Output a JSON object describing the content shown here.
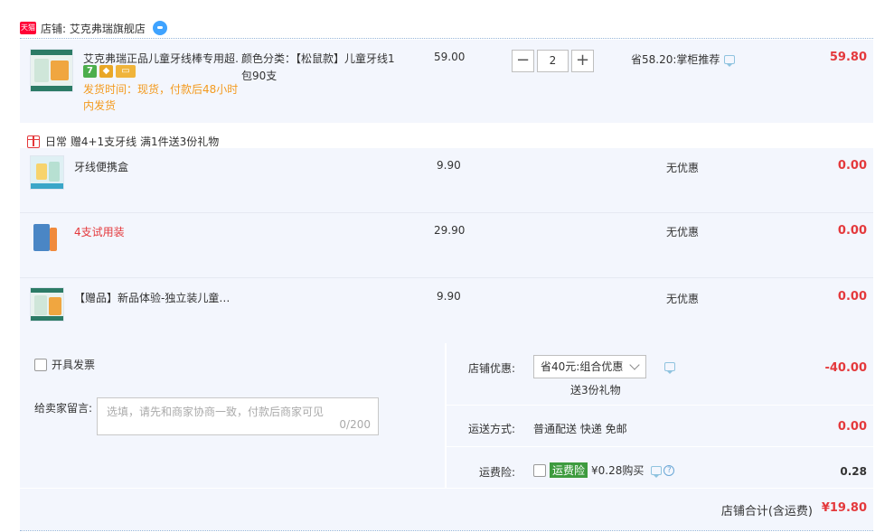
{
  "store": {
    "badge": "天猫",
    "name": "店铺: 艾克弗瑞旗舰店"
  },
  "main_item": {
    "title": "艾克弗瑞正品儿童牙线棒专用超…",
    "ship_time": "发货时间：现货，付款后48小时内发货",
    "sku": "颜色分类：【松鼠款】儿童牙线1包90支",
    "price": "59.00",
    "quantity": "2",
    "minus": "−",
    "plus": "+",
    "savings": "省58.20:掌柜推荐",
    "subtotal": "59.80",
    "mini_icons": [
      "7",
      "◆",
      "▭"
    ]
  },
  "gift": {
    "promo": "日常 赠4+1支牙线   满1件送3份礼物",
    "items": [
      {
        "name": "牙线便携盒",
        "price": "9.90",
        "discount": "无优惠",
        "subtotal": "0.00"
      },
      {
        "name": "4支试用装",
        "price": "29.90",
        "discount": "无优惠",
        "subtotal": "0.00"
      },
      {
        "name": "【赠品】新品体验-独立装儿童…",
        "price": "9.90",
        "discount": "无优惠",
        "subtotal": "0.00"
      }
    ]
  },
  "invoice": {
    "label": "开具发票"
  },
  "message": {
    "label": "给卖家留言:",
    "placeholder": "选填，请先和商家协商一致，付款后商家可见",
    "count": "0/200"
  },
  "discount": {
    "label": "店铺优惠:",
    "selected": "省40元:组合优惠",
    "note": "送3份礼物",
    "value": "-40.00"
  },
  "shipping": {
    "label": "运送方式:",
    "value_text": "普通配送 快递 免邮",
    "value": "0.00"
  },
  "insurance": {
    "label": "运费险:",
    "tag": "运费险",
    "text": "¥0.28购买",
    "value": "0.28"
  },
  "total": {
    "label": "店铺合计(含运费)",
    "value": "¥19.80"
  },
  "colors": {
    "accent_red": "#e4393c",
    "ship_orange": "#f39a1e",
    "panel_bg": "#f3f6fd"
  }
}
